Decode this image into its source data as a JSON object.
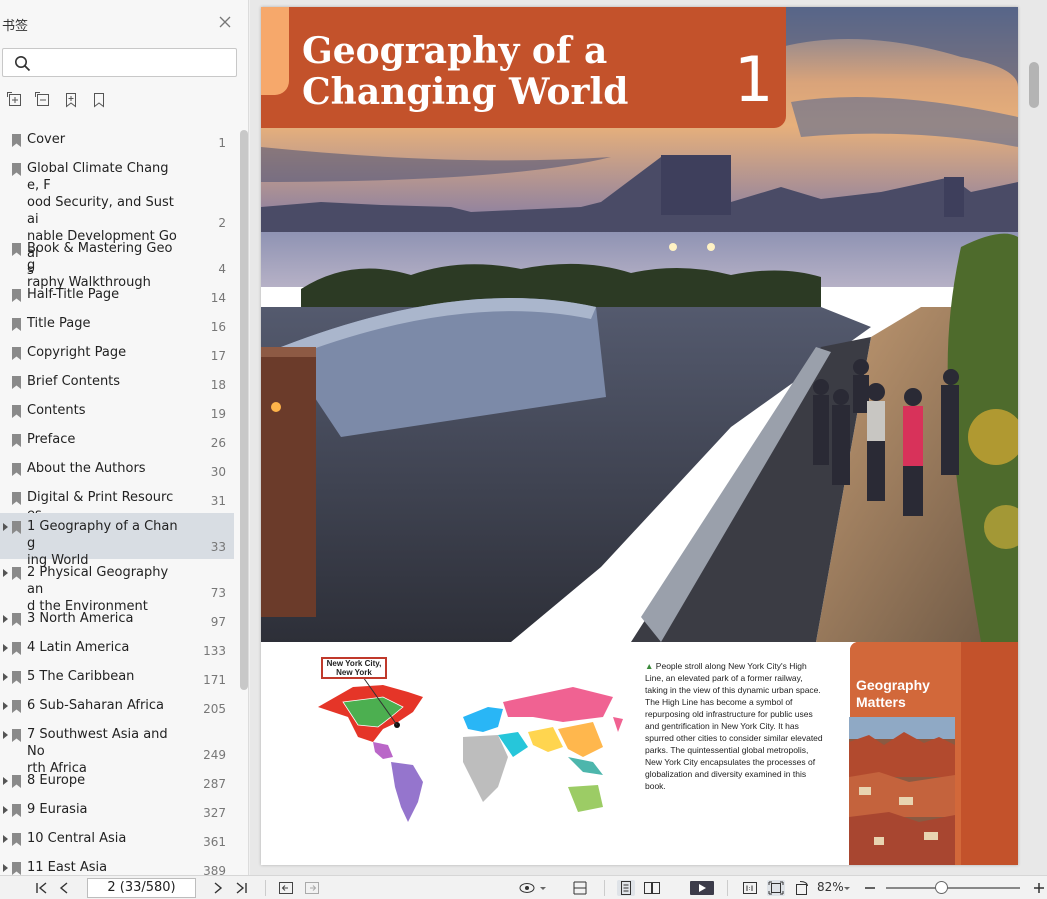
{
  "sidebar": {
    "title": "书签",
    "search": {
      "placeholder": "",
      "value": ""
    },
    "tools": [
      "expand-all-icon",
      "collapse-all-icon",
      "add-bookmark-icon",
      "bookmark-icon"
    ],
    "items": [
      {
        "label": "Cover",
        "page": "1",
        "expandable": false,
        "selected": false
      },
      {
        "label": "Global Climate Change, Food Security, and Sustainable Development Goals",
        "page": "2",
        "expandable": false,
        "selected": false
      },
      {
        "label": "Book & Mastering Geography Walkthrough",
        "page": "4",
        "expandable": false,
        "selected": false
      },
      {
        "label": "Half-Title Page",
        "page": "14",
        "expandable": false,
        "selected": false
      },
      {
        "label": "Title Page",
        "page": "16",
        "expandable": false,
        "selected": false
      },
      {
        "label": "Copyright Page",
        "page": "17",
        "expandable": false,
        "selected": false
      },
      {
        "label": "Brief Contents",
        "page": "18",
        "expandable": false,
        "selected": false
      },
      {
        "label": "Contents",
        "page": "19",
        "expandable": false,
        "selected": false
      },
      {
        "label": "Preface",
        "page": "26",
        "expandable": false,
        "selected": false
      },
      {
        "label": "About the Authors",
        "page": "30",
        "expandable": false,
        "selected": false
      },
      {
        "label": "Digital & Print Resources",
        "page": "31",
        "expandable": false,
        "selected": false
      },
      {
        "label": "1 Geography of a Changing World",
        "page": "33",
        "expandable": true,
        "selected": true
      },
      {
        "label": "2 Physical Geography and the Environment",
        "page": "73",
        "expandable": true,
        "selected": false
      },
      {
        "label": "3 North America",
        "page": "97",
        "expandable": true,
        "selected": false
      },
      {
        "label": "4 Latin America",
        "page": "133",
        "expandable": true,
        "selected": false
      },
      {
        "label": "5 The Caribbean",
        "page": "171",
        "expandable": true,
        "selected": false
      },
      {
        "label": "6 Sub-Saharan Africa",
        "page": "205",
        "expandable": true,
        "selected": false
      },
      {
        "label": "7 Southwest Asia and North Africa",
        "page": "249",
        "expandable": true,
        "selected": false
      },
      {
        "label": "8 Europe",
        "page": "287",
        "expandable": true,
        "selected": false
      },
      {
        "label": "9 Eurasia",
        "page": "327",
        "expandable": true,
        "selected": false
      },
      {
        "label": "10 Central Asia",
        "page": "361",
        "expandable": true,
        "selected": false
      },
      {
        "label": "11 East Asia",
        "page": "389",
        "expandable": true,
        "selected": false
      }
    ],
    "display_lines": [
      [
        "Cover"
      ],
      [
        "Global Climate Change, F",
        "ood Security, and Sustai",
        "nable Development Goal",
        "s"
      ],
      [
        "Book & Mastering Geog",
        "raphy Walkthrough"
      ],
      [
        "Half-Title Page"
      ],
      [
        "Title Page"
      ],
      [
        "Copyright Page"
      ],
      [
        "Brief Contents"
      ],
      [
        "Contents"
      ],
      [
        "Preface"
      ],
      [
        "About the Authors"
      ],
      [
        "Digital & Print Resources"
      ],
      [
        "1 Geography of a Chang",
        "ing World"
      ],
      [
        "2 Physical Geography an",
        "d the Environment"
      ],
      [
        "3 North America"
      ],
      [
        "4 Latin America"
      ],
      [
        "5 The Caribbean"
      ],
      [
        "6 Sub-Saharan Africa"
      ],
      [
        "7 Southwest Asia and No",
        "rth Africa"
      ],
      [
        "8 Europe"
      ],
      [
        "9 Eurasia"
      ],
      [
        "10 Central Asia"
      ],
      [
        "11 East Asia"
      ]
    ]
  },
  "page": {
    "chapter_title": "Geography of a\nChanging World",
    "chapter_number": "1",
    "map_callout": "New York City,\nNew York",
    "caption_marker": "▲",
    "caption": "People stroll along New York City's High Line, an elevated park of a former railway, taking in the view of this dynamic urban space. The High Line has become a symbol of repurposing old infrastructure for public uses and gentrification in New York City. It has spurred other cities to consider similar elevated parks. The quintessential global metropolis, New York City encapsulates the processes of globalization and diversity examined in this book.",
    "sidebar_box_title": "Geography\nMatters"
  },
  "statusbar": {
    "page_indicator": "2 (33/580)",
    "zoom": "82%",
    "zoom_level_fraction": 0.41
  },
  "colors": {
    "accent": "#c3522b",
    "tab": "#f6a86b",
    "selection": "#d8dde3"
  }
}
